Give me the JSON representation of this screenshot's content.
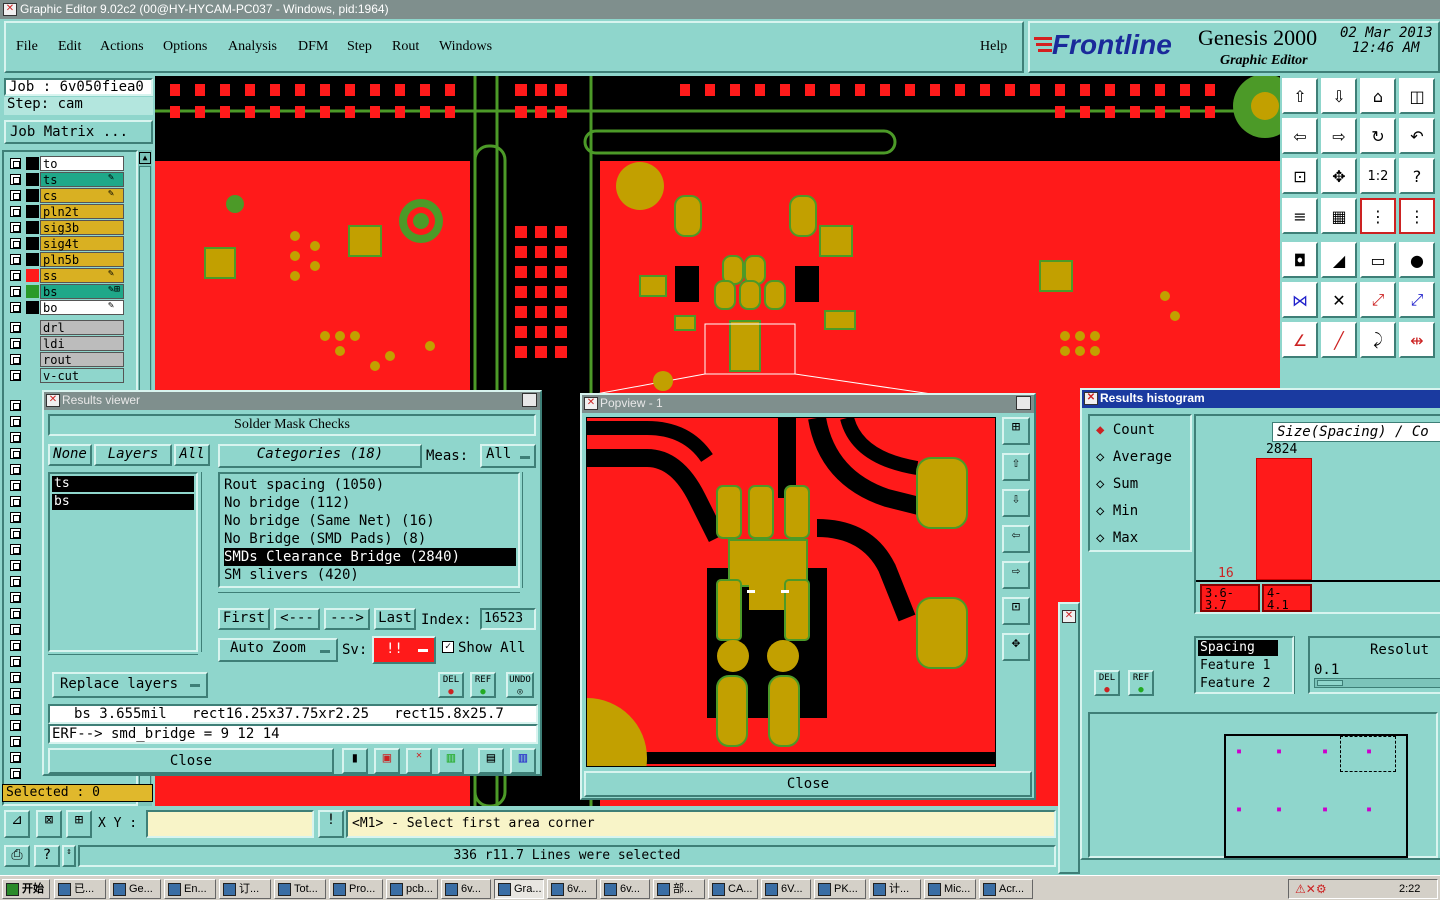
{
  "window": {
    "title": "Graphic Editor 9.02c2 (00@HY-HYCAM-PC037 - Windows, pid:1964)"
  },
  "menu": [
    "File",
    "Edit",
    "Actions",
    "Options",
    "Analysis",
    "DFM",
    "Step",
    "Rout",
    "Windows"
  ],
  "help_label": "Help",
  "brand": {
    "logo": "Frontline",
    "product": "Genesis 2000",
    "subtitle": "Graphic Editor",
    "date": "02 Mar 2013",
    "time": "12:46 AM"
  },
  "job": {
    "job_line": "Job : 6v050fiea0",
    "step_line": "Step: cam",
    "matrix_button": "Job Matrix ..."
  },
  "layers": [
    {
      "name": "to",
      "color": "#ffffff",
      "chip": "#000000"
    },
    {
      "name": "ts",
      "color": "#1fa889",
      "chip": "#000000",
      "edit": "✎"
    },
    {
      "name": "cs",
      "color": "#d9b022",
      "chip": "#000000",
      "edit": "✎"
    },
    {
      "name": "pln2t",
      "color": "#d9b022",
      "chip": "#000000"
    },
    {
      "name": "sig3b",
      "color": "#d9b022",
      "chip": "#000000"
    },
    {
      "name": "sig4t",
      "color": "#d9b022",
      "chip": "#000000"
    },
    {
      "name": "pln5b",
      "color": "#d9b022",
      "chip": "#000000"
    },
    {
      "name": "ss",
      "color": "#d9b022",
      "chip": "#ff1a1a",
      "edit": "✎"
    },
    {
      "name": "bs",
      "color": "#1fa889",
      "chip": "#2a9a2a",
      "edit": "✎⊞"
    },
    {
      "name": "bo",
      "color": "#ffffff",
      "chip": "#000000",
      "edit": "✎"
    }
  ],
  "layers2": [
    {
      "name": "drl",
      "color": "#bcbcbc"
    },
    {
      "name": "ldi",
      "color": "#bcbcbc"
    },
    {
      "name": "rout",
      "color": "#bcbcbc"
    },
    {
      "name": "v-cut",
      "color": "#8fd6cc"
    }
  ],
  "selected_label": "Selected : 0",
  "results_viewer": {
    "title": "Results viewer",
    "heading": "Solder Mask Checks",
    "none_label": "None",
    "layers_label": "Layers",
    "all_label": "All",
    "layers": [
      "ts",
      "bs"
    ],
    "categories_header": "Categories (18)",
    "meas_label": "Meas:",
    "meas_value": "All",
    "categories": [
      "Rout spacing (1050)",
      "No bridge (112)",
      "No bridge (Same Net) (16)",
      "No Bridge (SMD Pads) (8)",
      "SMDs Clearance Bridge (2840)",
      "SM slivers (420)"
    ],
    "selected_index": 4,
    "nav": {
      "first": "First",
      "prev": "<---",
      "next": "--->",
      "last": "Last",
      "index_label": "Index:",
      "index_value": "16523"
    },
    "auto_zoom": "Auto Zoom",
    "sv_label": "Sv:",
    "sv_value": "!!",
    "show_all": "Show All",
    "replace_layers": "Replace layers",
    "del": "DEL",
    "ref": "REF",
    "undo": "UNDO",
    "measure_line": "bs 3.655mil   rect16.25x37.75xr2.25   rect15.8x25.7",
    "erf_line": "ERF--> smd_bridge = 9 12 14",
    "close": "Close"
  },
  "popview": {
    "title": "Popview - 1",
    "close": "Close"
  },
  "histogram": {
    "title": "Results histogram",
    "modes": [
      "Count",
      "Average",
      "Sum",
      "Min",
      "Max"
    ],
    "selected_mode": "Count",
    "header": "Size(Spacing) / Co",
    "bars": [
      {
        "range_from": "3.6-",
        "range_to": "3.7",
        "count": 16
      },
      {
        "range_from": "4-",
        "range_to": "4.1",
        "count": 2824
      }
    ],
    "list_items": [
      "Spacing",
      "Feature 1",
      "Feature 2"
    ],
    "resolution_label": "Resolut",
    "resolution_value": "0.1",
    "del": "DEL",
    "ref": "REF"
  },
  "status": {
    "xy_label": "X Y :",
    "prompt": "<M1> - Select first area corner",
    "message": "336 r11.7 Lines were selected"
  },
  "taskbar": {
    "start": "开始",
    "tasks": [
      "已...",
      "Ge...",
      "En...",
      "订...",
      "Tot...",
      "Pro...",
      "pcb...",
      "6v...",
      "Gra...",
      "6v...",
      "6v...",
      "部...",
      "CA...",
      "6V...",
      "PK...",
      "计...",
      "Mic...",
      "Acr..."
    ],
    "active_index": 8,
    "clock": "2:22"
  },
  "colors": {
    "teal": "#8fd6cc",
    "board_red": "#ff1a1a",
    "pad_gold": "#c2a000",
    "trace_green": "#4c9a28",
    "selection": "#000000"
  }
}
